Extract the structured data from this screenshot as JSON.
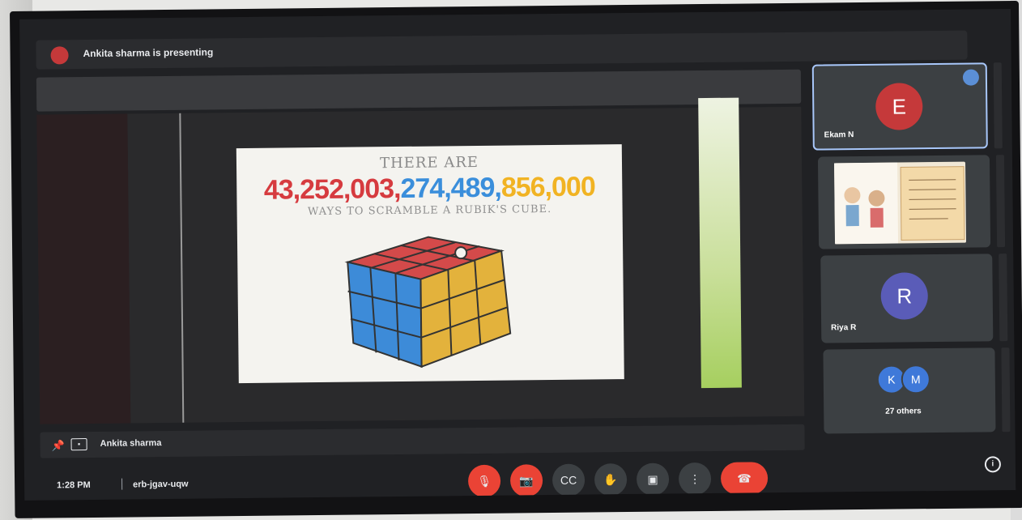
{
  "presenting": {
    "text": "Ankita sharma is presenting"
  },
  "slide": {
    "line1": "THERE ARE",
    "number_parts": [
      {
        "text": "43,252,003,",
        "color": "#d63b3f"
      },
      {
        "text": "274,489,",
        "color": "#3a8edb"
      },
      {
        "text": "856,000",
        "color": "#f1b323"
      }
    ],
    "line3": "WAYS TO SCRAMBLE A RUBIK'S CUBE."
  },
  "presenter_bar": {
    "name": "Ankita sharma",
    "pin_icon": "pin-icon",
    "screen_icon": "present-screen-icon"
  },
  "participants": [
    {
      "initial": "E",
      "name": "Ekam N",
      "color": "#c5393a"
    },
    {
      "initial": "",
      "name": "",
      "color": ""
    },
    {
      "initial": "R",
      "name": "Riya R",
      "color": "#5a5cb8"
    }
  ],
  "others": {
    "initials": [
      "K",
      "M"
    ],
    "label": "27 others",
    "color": "#3f79d9"
  },
  "bottom": {
    "time": "1:28 PM",
    "meeting_code": "erb-jgav-uqw"
  },
  "controls": [
    {
      "name": "mic-off-button",
      "icon": "mic-off-icon",
      "glyph": "🎙",
      "style": "red"
    },
    {
      "name": "camera-off-button",
      "icon": "camera-off-icon",
      "glyph": "📷",
      "style": "red"
    },
    {
      "name": "captions-button",
      "icon": "captions-icon",
      "glyph": "CC",
      "style": "grey"
    },
    {
      "name": "raise-hand-button",
      "icon": "hand-icon",
      "glyph": "✋",
      "style": "grey"
    },
    {
      "name": "present-button",
      "icon": "present-icon",
      "glyph": "▣",
      "style": "grey"
    },
    {
      "name": "more-options-button",
      "icon": "more-vert-icon",
      "glyph": "⋮",
      "style": "grey"
    },
    {
      "name": "leave-call-button",
      "icon": "call-end-icon",
      "glyph": "☎",
      "style": "end"
    }
  ]
}
